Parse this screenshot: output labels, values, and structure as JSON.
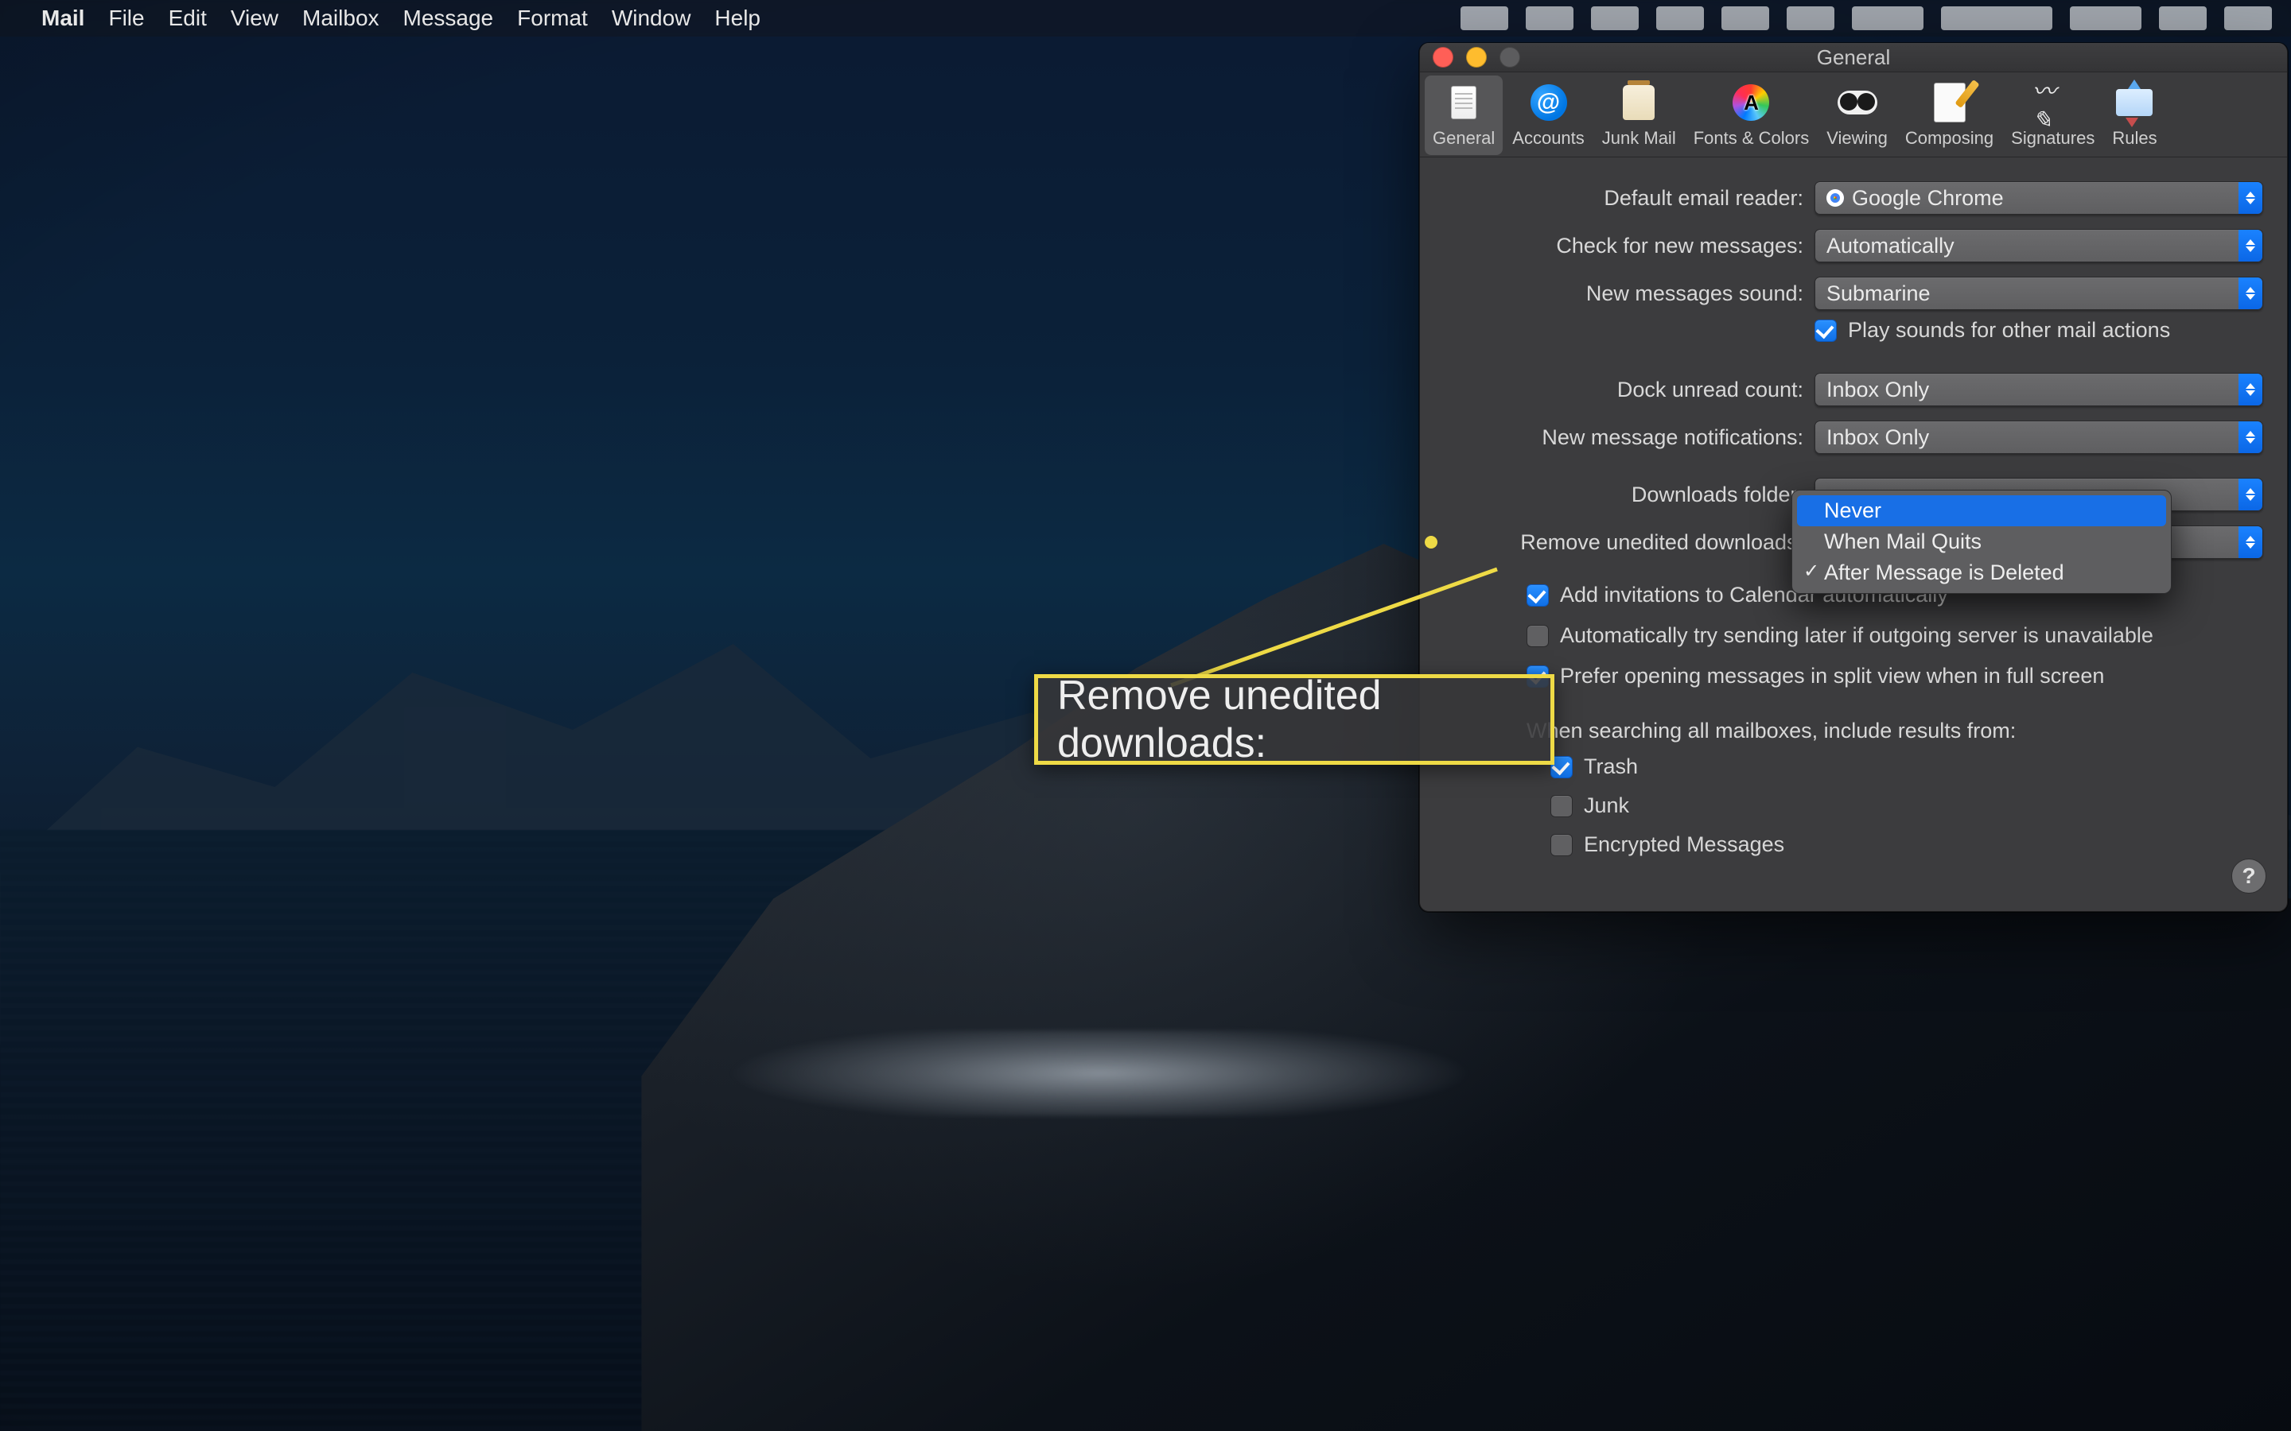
{
  "menubar": {
    "app_name": "Mail",
    "items": [
      "File",
      "Edit",
      "View",
      "Mailbox",
      "Message",
      "Format",
      "Window",
      "Help"
    ]
  },
  "window": {
    "title": "General",
    "tabs": {
      "general": "General",
      "accounts": "Accounts",
      "junk": "Junk Mail",
      "fonts": "Fonts & Colors",
      "viewing": "Viewing",
      "composing": "Composing",
      "signatures": "Signatures",
      "rules": "Rules"
    }
  },
  "form": {
    "default_reader_label": "Default email reader:",
    "default_reader_value": "Google Chrome",
    "check_messages_label": "Check for new messages:",
    "check_messages_value": "Automatically",
    "sound_label": "New messages sound:",
    "sound_value": "Submarine",
    "play_sounds_label": "Play sounds for other mail actions",
    "dock_count_label": "Dock unread count:",
    "dock_count_value": "Inbox Only",
    "notifications_label": "New message notifications:",
    "notifications_value": "Inbox Only",
    "downloads_folder_label": "Downloads folder:",
    "remove_downloads_label": "Remove unedited downloads:",
    "remove_downloads_options": {
      "never": "Never",
      "when_quits": "When Mail Quits",
      "after_delete": "After Message is Deleted"
    },
    "add_invites_label": "Add invitations to Calendar automatically",
    "auto_resend_label": "Automatically try sending later if outgoing server is unavailable",
    "split_view_label": "Prefer opening messages in split view when in full screen",
    "search_include_label": "When searching all mailboxes, include results from:",
    "search_include": {
      "trash": "Trash",
      "junk": "Junk",
      "encrypted": "Encrypted Messages"
    },
    "help_label": "?"
  },
  "callout": {
    "text": "Remove unedited downloads:"
  },
  "colors": {
    "accent": "#1a82ff",
    "annotation": "#eeda46"
  }
}
